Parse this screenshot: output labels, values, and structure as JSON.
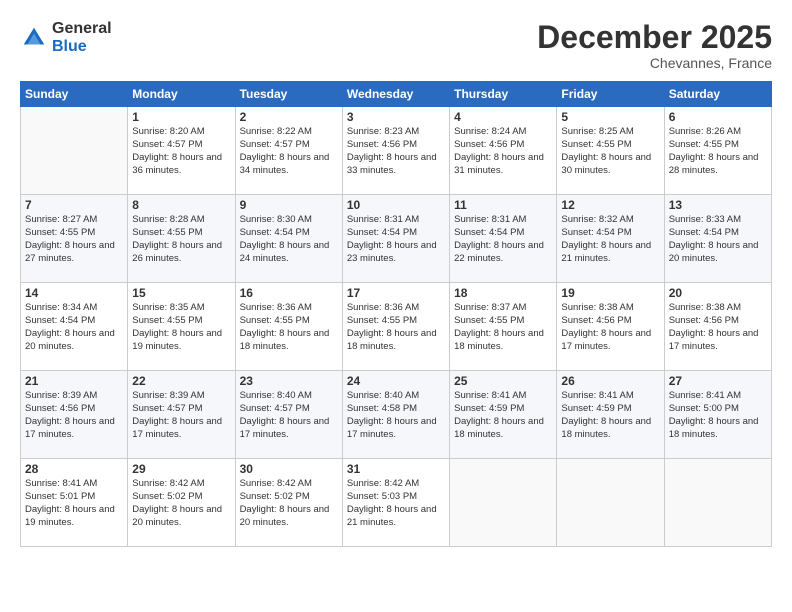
{
  "header": {
    "logo_general": "General",
    "logo_blue": "Blue",
    "month_title": "December 2025",
    "location": "Chevannes, France"
  },
  "weekdays": [
    "Sunday",
    "Monday",
    "Tuesday",
    "Wednesday",
    "Thursday",
    "Friday",
    "Saturday"
  ],
  "weeks": [
    [
      {
        "day": "",
        "sunrise": "",
        "sunset": "",
        "daylight": ""
      },
      {
        "day": "1",
        "sunrise": "Sunrise: 8:20 AM",
        "sunset": "Sunset: 4:57 PM",
        "daylight": "Daylight: 8 hours and 36 minutes."
      },
      {
        "day": "2",
        "sunrise": "Sunrise: 8:22 AM",
        "sunset": "Sunset: 4:57 PM",
        "daylight": "Daylight: 8 hours and 34 minutes."
      },
      {
        "day": "3",
        "sunrise": "Sunrise: 8:23 AM",
        "sunset": "Sunset: 4:56 PM",
        "daylight": "Daylight: 8 hours and 33 minutes."
      },
      {
        "day": "4",
        "sunrise": "Sunrise: 8:24 AM",
        "sunset": "Sunset: 4:56 PM",
        "daylight": "Daylight: 8 hours and 31 minutes."
      },
      {
        "day": "5",
        "sunrise": "Sunrise: 8:25 AM",
        "sunset": "Sunset: 4:55 PM",
        "daylight": "Daylight: 8 hours and 30 minutes."
      },
      {
        "day": "6",
        "sunrise": "Sunrise: 8:26 AM",
        "sunset": "Sunset: 4:55 PM",
        "daylight": "Daylight: 8 hours and 28 minutes."
      }
    ],
    [
      {
        "day": "7",
        "sunrise": "Sunrise: 8:27 AM",
        "sunset": "Sunset: 4:55 PM",
        "daylight": "Daylight: 8 hours and 27 minutes."
      },
      {
        "day": "8",
        "sunrise": "Sunrise: 8:28 AM",
        "sunset": "Sunset: 4:55 PM",
        "daylight": "Daylight: 8 hours and 26 minutes."
      },
      {
        "day": "9",
        "sunrise": "Sunrise: 8:30 AM",
        "sunset": "Sunset: 4:54 PM",
        "daylight": "Daylight: 8 hours and 24 minutes."
      },
      {
        "day": "10",
        "sunrise": "Sunrise: 8:31 AM",
        "sunset": "Sunset: 4:54 PM",
        "daylight": "Daylight: 8 hours and 23 minutes."
      },
      {
        "day": "11",
        "sunrise": "Sunrise: 8:31 AM",
        "sunset": "Sunset: 4:54 PM",
        "daylight": "Daylight: 8 hours and 22 minutes."
      },
      {
        "day": "12",
        "sunrise": "Sunrise: 8:32 AM",
        "sunset": "Sunset: 4:54 PM",
        "daylight": "Daylight: 8 hours and 21 minutes."
      },
      {
        "day": "13",
        "sunrise": "Sunrise: 8:33 AM",
        "sunset": "Sunset: 4:54 PM",
        "daylight": "Daylight: 8 hours and 20 minutes."
      }
    ],
    [
      {
        "day": "14",
        "sunrise": "Sunrise: 8:34 AM",
        "sunset": "Sunset: 4:54 PM",
        "daylight": "Daylight: 8 hours and 20 minutes."
      },
      {
        "day": "15",
        "sunrise": "Sunrise: 8:35 AM",
        "sunset": "Sunset: 4:55 PM",
        "daylight": "Daylight: 8 hours and 19 minutes."
      },
      {
        "day": "16",
        "sunrise": "Sunrise: 8:36 AM",
        "sunset": "Sunset: 4:55 PM",
        "daylight": "Daylight: 8 hours and 18 minutes."
      },
      {
        "day": "17",
        "sunrise": "Sunrise: 8:36 AM",
        "sunset": "Sunset: 4:55 PM",
        "daylight": "Daylight: 8 hours and 18 minutes."
      },
      {
        "day": "18",
        "sunrise": "Sunrise: 8:37 AM",
        "sunset": "Sunset: 4:55 PM",
        "daylight": "Daylight: 8 hours and 18 minutes."
      },
      {
        "day": "19",
        "sunrise": "Sunrise: 8:38 AM",
        "sunset": "Sunset: 4:56 PM",
        "daylight": "Daylight: 8 hours and 17 minutes."
      },
      {
        "day": "20",
        "sunrise": "Sunrise: 8:38 AM",
        "sunset": "Sunset: 4:56 PM",
        "daylight": "Daylight: 8 hours and 17 minutes."
      }
    ],
    [
      {
        "day": "21",
        "sunrise": "Sunrise: 8:39 AM",
        "sunset": "Sunset: 4:56 PM",
        "daylight": "Daylight: 8 hours and 17 minutes."
      },
      {
        "day": "22",
        "sunrise": "Sunrise: 8:39 AM",
        "sunset": "Sunset: 4:57 PM",
        "daylight": "Daylight: 8 hours and 17 minutes."
      },
      {
        "day": "23",
        "sunrise": "Sunrise: 8:40 AM",
        "sunset": "Sunset: 4:57 PM",
        "daylight": "Daylight: 8 hours and 17 minutes."
      },
      {
        "day": "24",
        "sunrise": "Sunrise: 8:40 AM",
        "sunset": "Sunset: 4:58 PM",
        "daylight": "Daylight: 8 hours and 17 minutes."
      },
      {
        "day": "25",
        "sunrise": "Sunrise: 8:41 AM",
        "sunset": "Sunset: 4:59 PM",
        "daylight": "Daylight: 8 hours and 18 minutes."
      },
      {
        "day": "26",
        "sunrise": "Sunrise: 8:41 AM",
        "sunset": "Sunset: 4:59 PM",
        "daylight": "Daylight: 8 hours and 18 minutes."
      },
      {
        "day": "27",
        "sunrise": "Sunrise: 8:41 AM",
        "sunset": "Sunset: 5:00 PM",
        "daylight": "Daylight: 8 hours and 18 minutes."
      }
    ],
    [
      {
        "day": "28",
        "sunrise": "Sunrise: 8:41 AM",
        "sunset": "Sunset: 5:01 PM",
        "daylight": "Daylight: 8 hours and 19 minutes."
      },
      {
        "day": "29",
        "sunrise": "Sunrise: 8:42 AM",
        "sunset": "Sunset: 5:02 PM",
        "daylight": "Daylight: 8 hours and 20 minutes."
      },
      {
        "day": "30",
        "sunrise": "Sunrise: 8:42 AM",
        "sunset": "Sunset: 5:02 PM",
        "daylight": "Daylight: 8 hours and 20 minutes."
      },
      {
        "day": "31",
        "sunrise": "Sunrise: 8:42 AM",
        "sunset": "Sunset: 5:03 PM",
        "daylight": "Daylight: 8 hours and 21 minutes."
      },
      {
        "day": "",
        "sunrise": "",
        "sunset": "",
        "daylight": ""
      },
      {
        "day": "",
        "sunrise": "",
        "sunset": "",
        "daylight": ""
      },
      {
        "day": "",
        "sunrise": "",
        "sunset": "",
        "daylight": ""
      }
    ]
  ]
}
